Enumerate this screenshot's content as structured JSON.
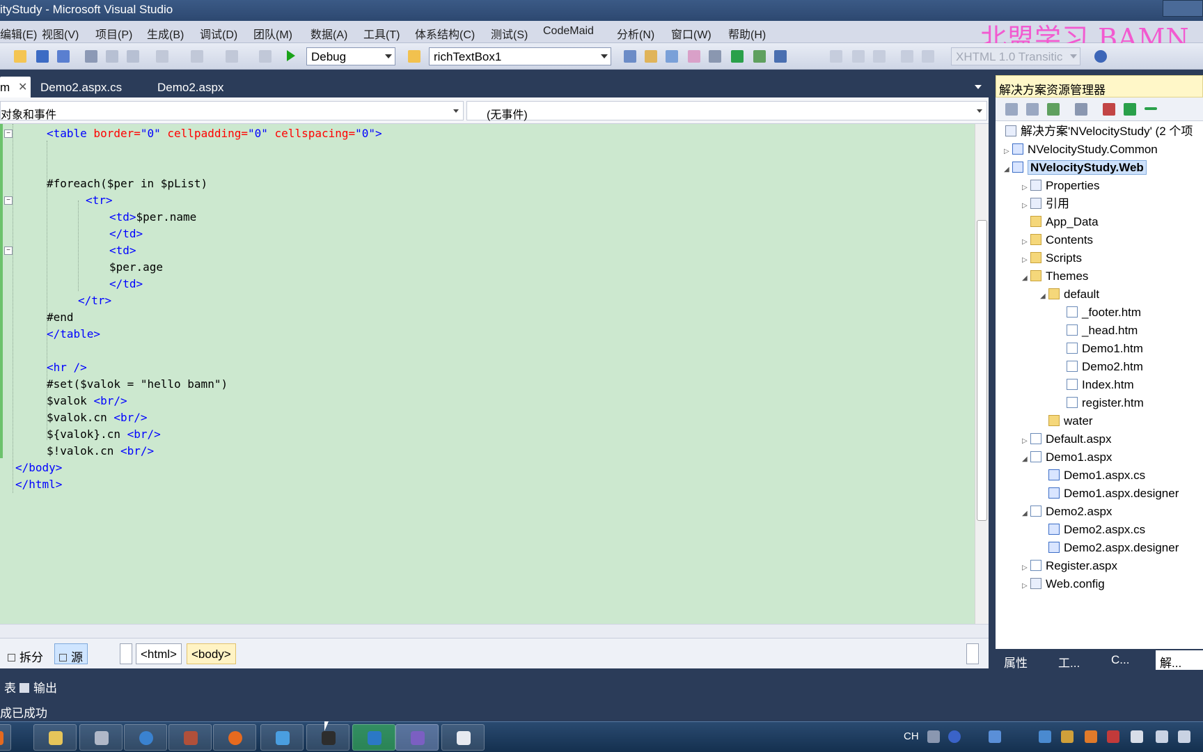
{
  "window": {
    "title": "ityStudy - Microsoft Visual Studio"
  },
  "watermark": "北盟学习 BAMN.",
  "menu": [
    "编辑(E)",
    "视图(V)",
    "项目(P)",
    "生成(B)",
    "调试(D)",
    "团队(M)",
    "数据(A)",
    "工具(T)",
    "体系结构(C)",
    "测试(S)",
    "CodeMaid",
    "分析(N)",
    "窗口(W)",
    "帮助(H)"
  ],
  "toolbar": {
    "config": "Debug",
    "find_target": "richTextBox1",
    "schema": "XHTML 1.0 Transitic"
  },
  "tabs": [
    {
      "label": "m",
      "active": true
    },
    {
      "label": "Demo2.aspx.cs",
      "active": false
    },
    {
      "label": "Demo2.aspx",
      "active": false
    }
  ],
  "navbar": {
    "objects": "对象和事件",
    "events": "(无事件)"
  },
  "code": {
    "table_open": [
      "<table",
      " border=",
      "\"0\"",
      " cellpadding=",
      "\"0\"",
      " cellspacing=",
      "\"0\"",
      ">"
    ],
    "foreach": "#foreach($per in $pList)",
    "tr_open": "<tr>",
    "td_open1": "<td>",
    "per_name": "$per.name",
    "td_close1": "</td>",
    "td_open2": "<td>",
    "per_age": "$per.age",
    "td_close2": "</td>",
    "tr_close": "</tr>",
    "end": "#end",
    "table_close": "</table>",
    "hr": "<hr />",
    "set": "#set($valok = \"hello bamn\")",
    "valok": "$valok ",
    "valok_cn": "$valok.cn ",
    "valok_brace": "${valok}.cn ",
    "valok_silent": "$!valok.cn ",
    "br": "<br/>",
    "body_close": "</body>",
    "html_close": "</html>"
  },
  "viewbar": {
    "split": "拆分",
    "source": "源",
    "crumb_html": "<html>",
    "crumb_body": "<body>"
  },
  "solution_explorer": {
    "title": "解决方案资源管理器",
    "solution": "解决方案'NVelocityStudy' (2 个项",
    "nodes": [
      "NVelocityStudy.Common",
      "NVelocityStudy.Web",
      "Properties",
      "引用",
      "App_Data",
      "Contents",
      "Scripts",
      "Themes",
      "default",
      "_footer.htm",
      "_head.htm",
      "Demo1.htm",
      "Demo2.htm",
      "Index.htm",
      "register.htm",
      "water",
      "Default.aspx",
      "Demo1.aspx",
      "Demo1.aspx.cs",
      "Demo1.aspx.designer",
      "Demo2.aspx",
      "Demo2.aspx.cs",
      "Demo2.aspx.designer",
      "Register.aspx",
      "Web.config"
    ],
    "bottom_tabs": [
      "属性",
      "工...",
      "C...",
      "解..."
    ]
  },
  "output": {
    "tab_list": "表",
    "tab_output": "输出",
    "status": "成已成功"
  },
  "taskbar": {
    "lang": "CH"
  }
}
